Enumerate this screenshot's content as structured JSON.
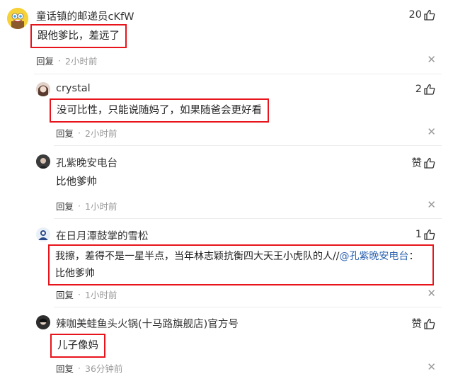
{
  "comments": [
    {
      "username": "童话镇的邮递员cKfW",
      "likes": "20",
      "content": "跟他爹比，差远了",
      "reply_label": "回复",
      "dot": "·",
      "time": "2小时前",
      "close": "✕"
    },
    {
      "username": "crystal",
      "likes": "2",
      "content": "没可比性，只能说随妈了，如果随爸会更好看",
      "reply_label": "回复",
      "dot": "·",
      "time": "2小时前",
      "close": "✕"
    },
    {
      "username": "孔紫晚安电台",
      "likes": "赞",
      "content": "比他爹帅",
      "reply_label": "回复",
      "dot": "·",
      "time": "1小时前",
      "close": "✕"
    },
    {
      "username": "在日月潭鼓掌的雪松",
      "likes": "1",
      "content_line1": "我擦，差得不是一星半点，当年林志颖抗衡四大天王小虎队的人//",
      "mention": "@孔紫晚安电台",
      "content_line1_end": "：",
      "content_line2": "比他爹帅",
      "reply_label": "回复",
      "dot": "·",
      "time": "1小时前",
      "close": "✕"
    },
    {
      "username": "辣咖美蛙鱼头火锅(十马路旗舰店)官方号",
      "likes": "赞",
      "content": "儿子像妈",
      "reply_label": "回复",
      "dot": "·",
      "time": "36分钟前",
      "close": "✕"
    }
  ],
  "colors": {
    "highlight_box": "#e8141b",
    "mention": "#2d63b0",
    "muted": "#999999"
  },
  "icons": [
    "spongebob-avatar",
    "user-avatar",
    "thumbs-up-icon",
    "close-icon"
  ]
}
